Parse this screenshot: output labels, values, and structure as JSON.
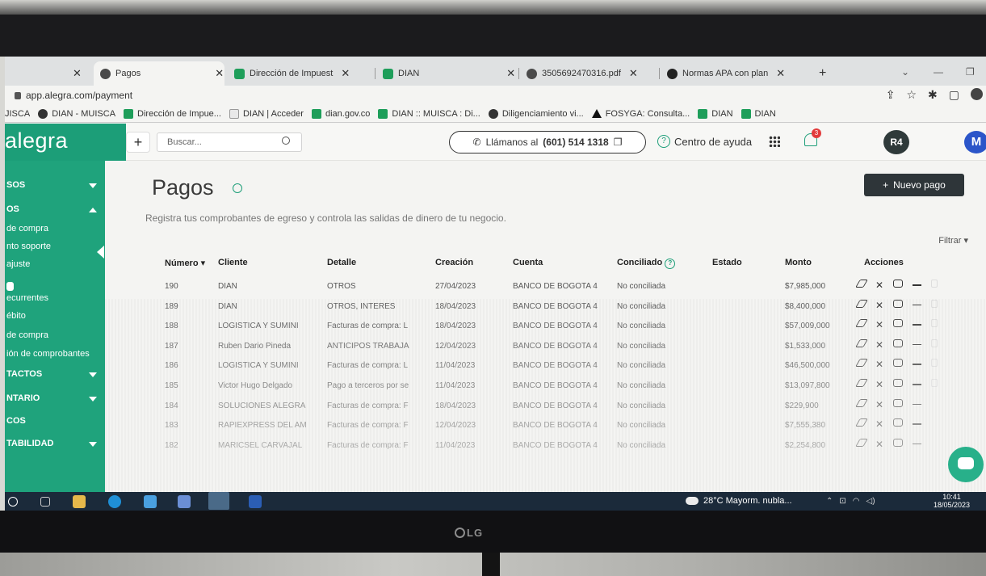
{
  "browser": {
    "tabs": [
      {
        "label": "",
        "favicon": "partial-tab"
      },
      {
        "label": "Pagos",
        "favicon": "alegra-icon",
        "active": true
      },
      {
        "label": "Dirección de Impuest",
        "favicon": "dian-green-icon"
      },
      {
        "label": "DIAN",
        "favicon": "dian-green-icon"
      },
      {
        "label": "3505692470316.pdf",
        "favicon": "globe-icon"
      },
      {
        "label": "Normas APA con plan",
        "favicon": "normas-icon"
      }
    ],
    "new_tab": "+",
    "url": "app.alegra.com/payment",
    "bookmarks": [
      {
        "label": "JISCA",
        "favicon": "none"
      },
      {
        "label": "DIAN - MUISCA",
        "favicon": "globe-icon"
      },
      {
        "label": "Dirección de Impue...",
        "favicon": "dian-green-icon"
      },
      {
        "label": "DIAN | Acceder",
        "favicon": "doc-icon"
      },
      {
        "label": "dian.gov.co",
        "favicon": "dian-green-icon"
      },
      {
        "label": "DIAN :: MUISCA : Di...",
        "favicon": "dian-green-icon"
      },
      {
        "label": "Diligenciamiento vi...",
        "favicon": "globe-icon"
      },
      {
        "label": "FOSYGA: Consulta...",
        "favicon": "triangle-icon"
      },
      {
        "label": "DIAN",
        "favicon": "dian-green-icon"
      },
      {
        "label": "DIAN",
        "favicon": "dian-green-icon"
      }
    ]
  },
  "header": {
    "logo": "alegra",
    "plus": "+",
    "search_placeholder": "Buscar...",
    "call_label": "Llámanos al",
    "call_number": "(601) 514 1318",
    "help_label": "Centro de ayuda",
    "notification_count": "3",
    "company_logo": "R4",
    "avatar_initial": "M"
  },
  "sidebar": {
    "items": [
      {
        "label": "SOS",
        "type": "section",
        "caret": "down"
      },
      {
        "label": "OS",
        "type": "section",
        "caret": "up"
      },
      {
        "label": "de compra",
        "type": "item"
      },
      {
        "label": "nto soporte",
        "type": "item"
      },
      {
        "label": "ajuste",
        "type": "item"
      },
      {
        "label": "ecurrentes",
        "type": "item"
      },
      {
        "label": "ébito",
        "type": "item"
      },
      {
        "label": "de compra",
        "type": "item"
      },
      {
        "label": "ión de comprobantes",
        "type": "item"
      },
      {
        "label": "TACTOS",
        "type": "section",
        "caret": "down"
      },
      {
        "label": "NTARIO",
        "type": "section",
        "caret": "down"
      },
      {
        "label": "COS",
        "type": "section"
      },
      {
        "label": "TABILIDAD",
        "type": "section",
        "caret": "down"
      }
    ]
  },
  "main": {
    "title": "Pagos",
    "subtitle": "Registra tus comprobantes de egreso y controla las salidas de dinero de tu negocio.",
    "new_button": "Nuevo pago",
    "new_button_icon": "+",
    "filter_label": "Filtrar",
    "columns": [
      "Número",
      "Cliente",
      "Detalle",
      "Creación",
      "Cuenta",
      "Conciliado",
      "Estado",
      "Monto",
      "Acciones"
    ],
    "rows": [
      {
        "numero": "190",
        "cliente": "DIAN",
        "detalle": "OTROS",
        "creacion": "27/04/2023",
        "cuenta": "BANCO DE BOGOTA 4",
        "conciliado": "No conciliada",
        "estado": "",
        "monto": "$7,985,000"
      },
      {
        "numero": "189",
        "cliente": "DIAN",
        "detalle": "OTROS, INTERES",
        "creacion": "18/04/2023",
        "cuenta": "BANCO DE BOGOTA 4",
        "conciliado": "No conciliada",
        "estado": "",
        "monto": "$8,400,000"
      },
      {
        "numero": "188",
        "cliente": "LOGISTICA Y SUMINI",
        "detalle": "Facturas de compra: L",
        "creacion": "18/04/2023",
        "cuenta": "BANCO DE BOGOTA 4",
        "conciliado": "No conciliada",
        "estado": "",
        "monto": "$57,009,000"
      },
      {
        "numero": "187",
        "cliente": "Ruben Dario Pineda",
        "detalle": "ANTICIPOS TRABAJA",
        "creacion": "12/04/2023",
        "cuenta": "BANCO DE BOGOTA 4",
        "conciliado": "No conciliada",
        "estado": "",
        "monto": "$1,533,000"
      },
      {
        "numero": "186",
        "cliente": "LOGISTICA Y SUMINI",
        "detalle": "Facturas de compra: L",
        "creacion": "11/04/2023",
        "cuenta": "BANCO DE BOGOTA 4",
        "conciliado": "No conciliada",
        "estado": "",
        "monto": "$46,500,000"
      },
      {
        "numero": "185",
        "cliente": "Victor Hugo Delgado",
        "detalle": "Pago a terceros por se",
        "creacion": "11/04/2023",
        "cuenta": "BANCO DE BOGOTA 4",
        "conciliado": "No conciliada",
        "estado": "",
        "monto": "$13,097,800"
      },
      {
        "numero": "184",
        "cliente": "SOLUCIONES ALEGRA",
        "detalle": "Facturas de compra: F",
        "creacion": "18/04/2023",
        "cuenta": "BANCO DE BOGOTA 4",
        "conciliado": "No conciliada",
        "estado": "",
        "monto": "$229,900"
      },
      {
        "numero": "183",
        "cliente": "RAPIEXPRESS DEL AM",
        "detalle": "Facturas de compra: F",
        "creacion": "12/04/2023",
        "cuenta": "BANCO DE BOGOTA 4",
        "conciliado": "No conciliada",
        "estado": "",
        "monto": "$7,555,380"
      },
      {
        "numero": "182",
        "cliente": "MARICSEL CARVAJAL",
        "detalle": "Facturas de compra: F",
        "creacion": "11/04/2023",
        "cuenta": "BANCO DE BOGOTA 4",
        "conciliado": "No conciliada",
        "estado": "",
        "monto": "$2,254,800"
      }
    ]
  },
  "taskbar": {
    "weather": "28°C  Mayorm. nubla...",
    "time": "10:41",
    "date": "18/05/2023"
  },
  "monitor": {
    "brand": "LG"
  },
  "colors": {
    "brand_green": "#1fa37c",
    "button_dark": "#2e3539",
    "avatar_blue": "#2b55c9",
    "badge_red": "#e23b3b"
  }
}
